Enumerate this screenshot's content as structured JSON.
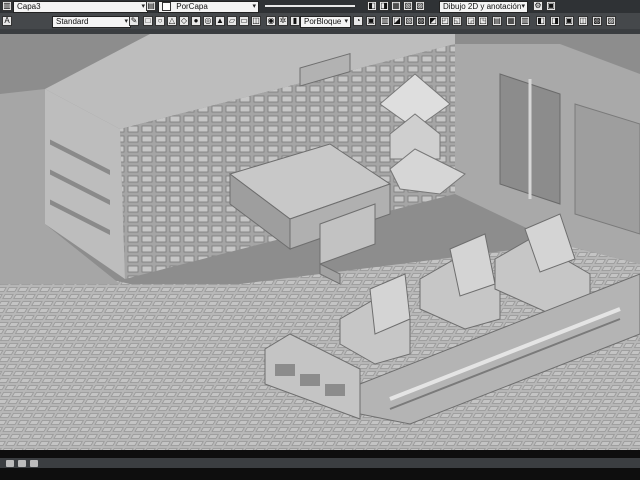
{
  "toolbar": {
    "layer_dropdown": "Capa3",
    "style_dropdown": "Standard",
    "color_dropdown": "PorCapa",
    "linetype_dropdown": "PorBloque",
    "workspace_dropdown": "Dibujo 2D y anotación"
  },
  "colors": {
    "toolbar_bg": "#3a3d40",
    "viewport_bg": "#8f8f8f",
    "model_light": "#c9c9c9",
    "model_dark": "#707070"
  },
  "icons": {
    "gear": "gear-icon",
    "layer_state": "layer-state-icon",
    "color_swatch": "color-swatch-icon"
  }
}
